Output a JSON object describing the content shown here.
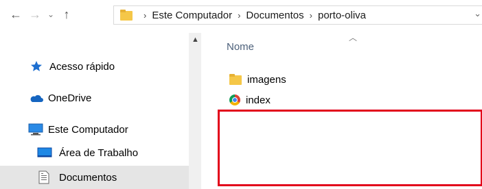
{
  "address_bar": {
    "crumbs": [
      "Este Computador",
      "Documentos",
      "porto-oliva"
    ],
    "separator": "›"
  },
  "nav": {
    "back": "←",
    "forward": "→",
    "recent": "⌄",
    "up": "↑"
  },
  "sidebar": {
    "items": [
      {
        "label": "Acesso rápido",
        "icon": "star-icon"
      },
      {
        "label": "OneDrive",
        "icon": "cloud-icon"
      },
      {
        "label": "Este Computador",
        "icon": "computer-icon"
      },
      {
        "label": "Área de Trabalho",
        "icon": "desktop-icon"
      },
      {
        "label": "Documentos",
        "icon": "document-icon",
        "selected": true
      }
    ]
  },
  "content": {
    "column_header": "Nome",
    "files": [
      {
        "name": "imagens",
        "icon": "folder-icon"
      },
      {
        "name": "index",
        "icon": "chrome-icon"
      }
    ]
  },
  "colors": {
    "highlight_box": "#e2001a",
    "selected_bg": "#e5e5e5",
    "header_text": "#4c607a"
  }
}
